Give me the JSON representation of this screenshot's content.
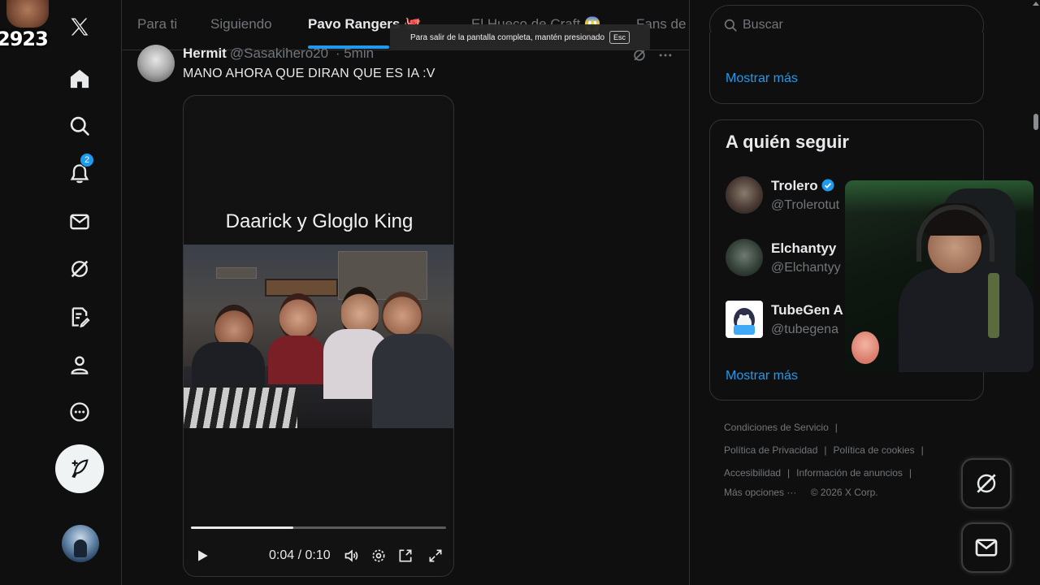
{
  "overlay": {
    "label": "2923"
  },
  "nav": {
    "items": [
      {
        "name": "x-logo-icon"
      },
      {
        "name": "home-icon"
      },
      {
        "name": "search-icon"
      },
      {
        "name": "bell-icon",
        "badge": "2"
      },
      {
        "name": "mail-icon"
      },
      {
        "name": "grok-icon"
      },
      {
        "name": "list-icon"
      },
      {
        "name": "profile-icon"
      },
      {
        "name": "more-circle-icon"
      }
    ],
    "post_button": {
      "icon": "feather-plus-icon"
    }
  },
  "tabs": [
    {
      "label": "Para ti",
      "active": false
    },
    {
      "label": "Siguiendo",
      "active": false
    },
    {
      "label": "Pavo Rangers 🐙",
      "active": true
    },
    {
      "label": "El Hueco de Craft 😱",
      "active": false
    },
    {
      "label": "Fans de",
      "active": false
    }
  ],
  "fullscreen_toast": {
    "text": "Para salir de la pantalla completa, mantén presionado",
    "key": "Esc"
  },
  "tweet": {
    "name": "Hermit",
    "handle": "@Sasakihero20",
    "time": "· 5min",
    "text": "MANO AHORA QUE DIRAN QUE ES IA :V",
    "video": {
      "caption": "Daarick y Gloglo King",
      "current_time": "0:04",
      "duration": "0:10",
      "time_display": "0:04 / 0:10",
      "progress_fraction": 0.4,
      "controls": [
        "play-icon",
        "volume-icon",
        "settings-icon",
        "popout-icon",
        "fullscreen-icon"
      ]
    }
  },
  "sidebar": {
    "search_placeholder": "Buscar",
    "show_more_top": "Mostrar más",
    "who_to_follow": {
      "title": "A quién seguir",
      "accounts": [
        {
          "name": "Trolero",
          "handle": "@Trolerotut",
          "verified": true
        },
        {
          "name": "Elchantyy",
          "handle": "@Elchantyy",
          "verified": false
        },
        {
          "name": "TubeGen A",
          "handle": "@tubegena",
          "verified": false
        }
      ],
      "show_more": "Mostrar más"
    },
    "footer": {
      "row1": [
        "Condiciones de Servicio"
      ],
      "row2": [
        "Política de Privacidad",
        "Política de cookies"
      ],
      "row3": [
        "Accesibilidad",
        "Información de anuncios"
      ],
      "row4": [
        "Más opciones ···",
        "© 2026 X Corp."
      ]
    }
  },
  "colors": {
    "accent": "#1d9bf0",
    "background": "#0f0f0f",
    "border": "#2f3336",
    "muted": "#71767b",
    "text": "#e7e9ea"
  }
}
